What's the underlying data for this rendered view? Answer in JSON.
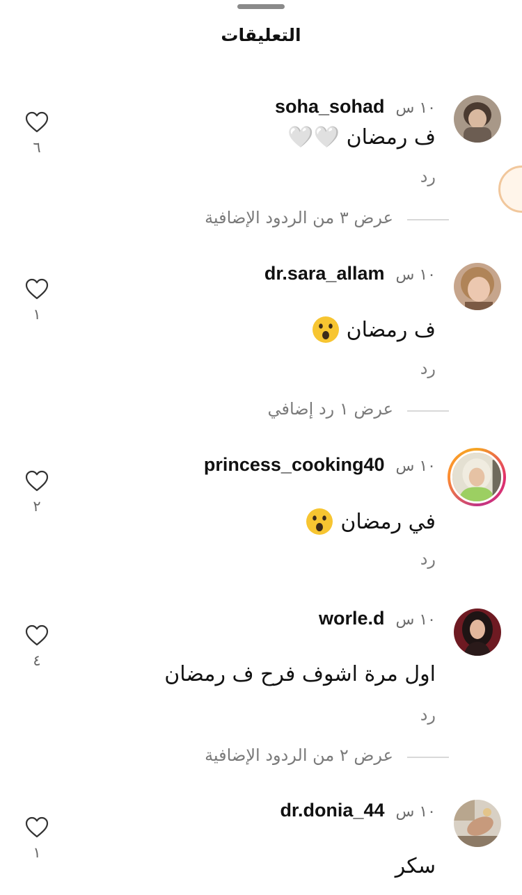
{
  "sheet": {
    "title": "التعليقات"
  },
  "comments": [
    {
      "username": "soha_sohad",
      "time": "١٠ س",
      "text": "ف رمضان 🤍🤍",
      "reply": "رد",
      "likes": "٦",
      "avatar": "child-avatar",
      "view_replies": "عرض ٣ من الردود الإضافية"
    },
    {
      "username": "dr.sara_allam",
      "time": "١٠ س",
      "text": "ف رمضان",
      "reply": "رد",
      "likes": "١",
      "avatar": "woman-avatar",
      "emoji": "astonished-face-emoji",
      "view_replies": "عرض ١ رد إضافي"
    },
    {
      "username": "princess_cooking40",
      "time": "١٠ س",
      "text": "في رمضان",
      "reply": "رد",
      "likes": "٢",
      "avatar": "hijab-woman-avatar",
      "emoji": "astonished-face-emoji",
      "has_story": true
    },
    {
      "username": "worle.d",
      "time": "١٠ س",
      "text": "اول مرة اشوف فرح ف رمضان",
      "reply": "رد",
      "likes": "٤",
      "avatar": "dark-hair-woman-avatar",
      "view_replies": "عرض ٢ من الردود الإضافية"
    },
    {
      "username": "dr.donia_44",
      "time": "١٠ س",
      "text": "سكر",
      "likes": "١",
      "avatar": "hand-avatar"
    }
  ],
  "colors": {
    "text": "#111111",
    "secondary": "#7a7a7a",
    "story_ring": "#e1306c",
    "emoji": "#f7c531"
  }
}
